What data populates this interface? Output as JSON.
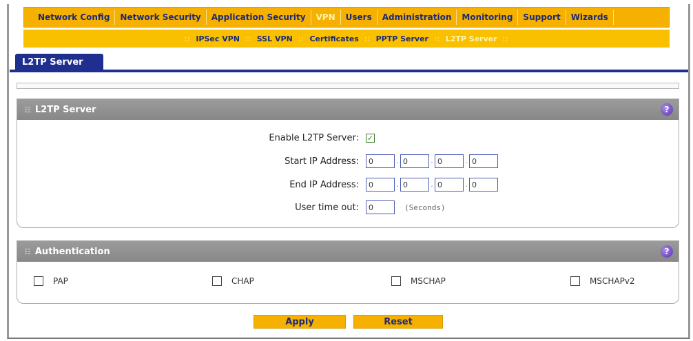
{
  "main_nav": [
    {
      "label": "Network Config",
      "active": false
    },
    {
      "label": "Network Security",
      "active": false
    },
    {
      "label": "Application Security",
      "active": false
    },
    {
      "label": "VPN",
      "active": true
    },
    {
      "label": "Users",
      "active": false
    },
    {
      "label": "Administration",
      "active": false
    },
    {
      "label": "Monitoring",
      "active": false
    },
    {
      "label": "Support",
      "active": false
    },
    {
      "label": "Wizards",
      "active": false
    }
  ],
  "sub_nav": [
    {
      "label": "IPSec VPN",
      "active": false
    },
    {
      "label": "SSL VPN",
      "active": false
    },
    {
      "label": "Certificates",
      "active": false
    },
    {
      "label": "PPTP Server",
      "active": false
    },
    {
      "label": "L2TP Server",
      "active": true
    }
  ],
  "tab": {
    "label": "L2TP Server"
  },
  "server_section": {
    "title": "L2TP Server",
    "help_glyph": "?",
    "enable_label": "Enable L2TP Server:",
    "enable_checked": true,
    "start_ip_label": "Start IP Address:",
    "start_ip": [
      "0",
      "0",
      "0",
      "0"
    ],
    "end_ip_label": "End IP Address:",
    "end_ip": [
      "0",
      "0",
      "0",
      "0"
    ],
    "timeout_label": "User time out:",
    "timeout_value": "0",
    "timeout_unit": "(Seconds)"
  },
  "auth_section": {
    "title": "Authentication",
    "help_glyph": "?",
    "options": [
      {
        "label": "PAP",
        "checked": false
      },
      {
        "label": "CHAP",
        "checked": false
      },
      {
        "label": "MSCHAP",
        "checked": false
      },
      {
        "label": "MSCHAPv2",
        "checked": false
      }
    ]
  },
  "buttons": {
    "apply": "Apply",
    "reset": "Reset"
  },
  "colors": {
    "nav_bg": "#f5b000",
    "tab_bg": "#1f2f8f",
    "header_bg": "#8f8f8f",
    "link_text": "#1c2a78"
  }
}
